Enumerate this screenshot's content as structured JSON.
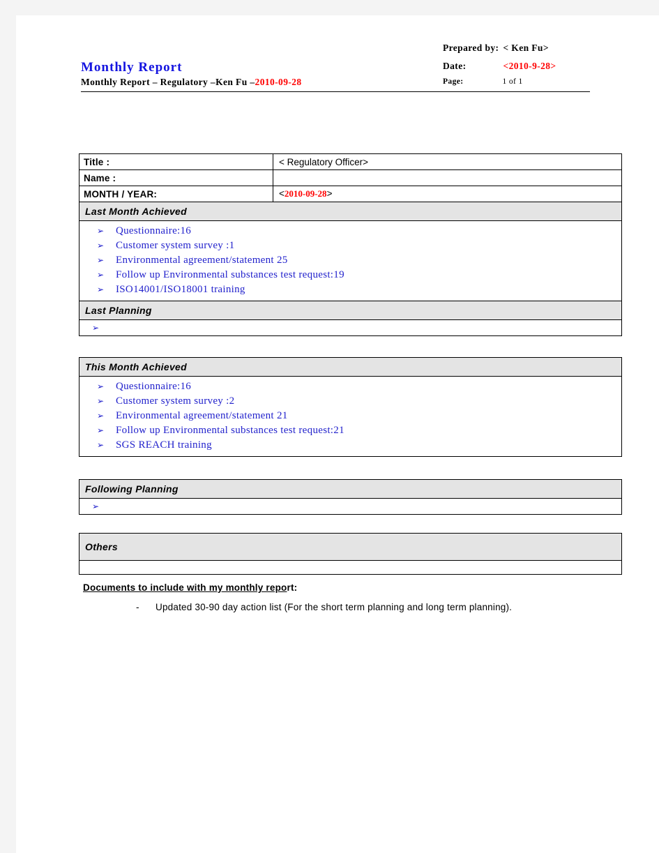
{
  "header": {
    "title": "Monthly  Report",
    "subtitle_plain": "Monthly  Report  –  Regulatory  –Ken  Fu  –",
    "subtitle_date": "2010-09-28",
    "prepared_by_label": "Prepared  by:",
    "prepared_by_value": "<  Ken  Fu>",
    "date_label": "Date:",
    "date_value": "<2010-9-28>",
    "page_label": "Page:",
    "page_value": "1 of 1"
  },
  "info_table": {
    "rows": [
      {
        "label": "Title :",
        "value_prefix": "<  Regulatory  Officer>",
        "value_red": "",
        "value_suffix": ""
      },
      {
        "label": "Name  :",
        "value_prefix": "",
        "value_red": "",
        "value_suffix": ""
      },
      {
        "label": "MONTH  /  YEAR:",
        "value_prefix": "<",
        "value_red": "2010-09-28",
        "value_suffix": ">"
      }
    ]
  },
  "sections": {
    "last_month_achieved": {
      "heading": "Last  Month  Achieved",
      "bullet_glyph": "➢",
      "items": [
        "Questionnaire:16",
        "Customer  system  survey  :1",
        "Environmental  agreement/statement  25",
        "Follow  up  Environmental  substances  test  request:19",
        "ISO14001/ISO18001  training"
      ]
    },
    "last_planning": {
      "heading": "Last  Planning",
      "bullet_glyph": "➢",
      "items": [
        ""
      ]
    },
    "this_month_achieved": {
      "heading": "This  Month  Achieved",
      "bullet_glyph": "➢",
      "items": [
        "Questionnaire:16",
        "Customer  system  survey  :2",
        "Environmental  agreement/statement  21",
        "Follow  up  Environmental  substances  test  request:21",
        "SGS  REACH  training"
      ]
    },
    "following_planning": {
      "heading": "Following  Planning",
      "bullet_glyph": "➢",
      "items": [
        ""
      ]
    },
    "others": {
      "heading": "Others",
      "body": ""
    }
  },
  "footer": {
    "documents_heading_underlined": "Documents  to  include  with  my  monthly  repo",
    "documents_heading_tail": "rt:",
    "note_dash": "-",
    "note_text": "Updated  30-90  day  action  list  (For  the  short  term  planning  and  long  term  planning)."
  },
  "colors": {
    "title_blue": "#1414e0",
    "accent_red": "#ff0000",
    "bullet_blue": "#2222cc",
    "section_gray": "#e4e4e4"
  }
}
